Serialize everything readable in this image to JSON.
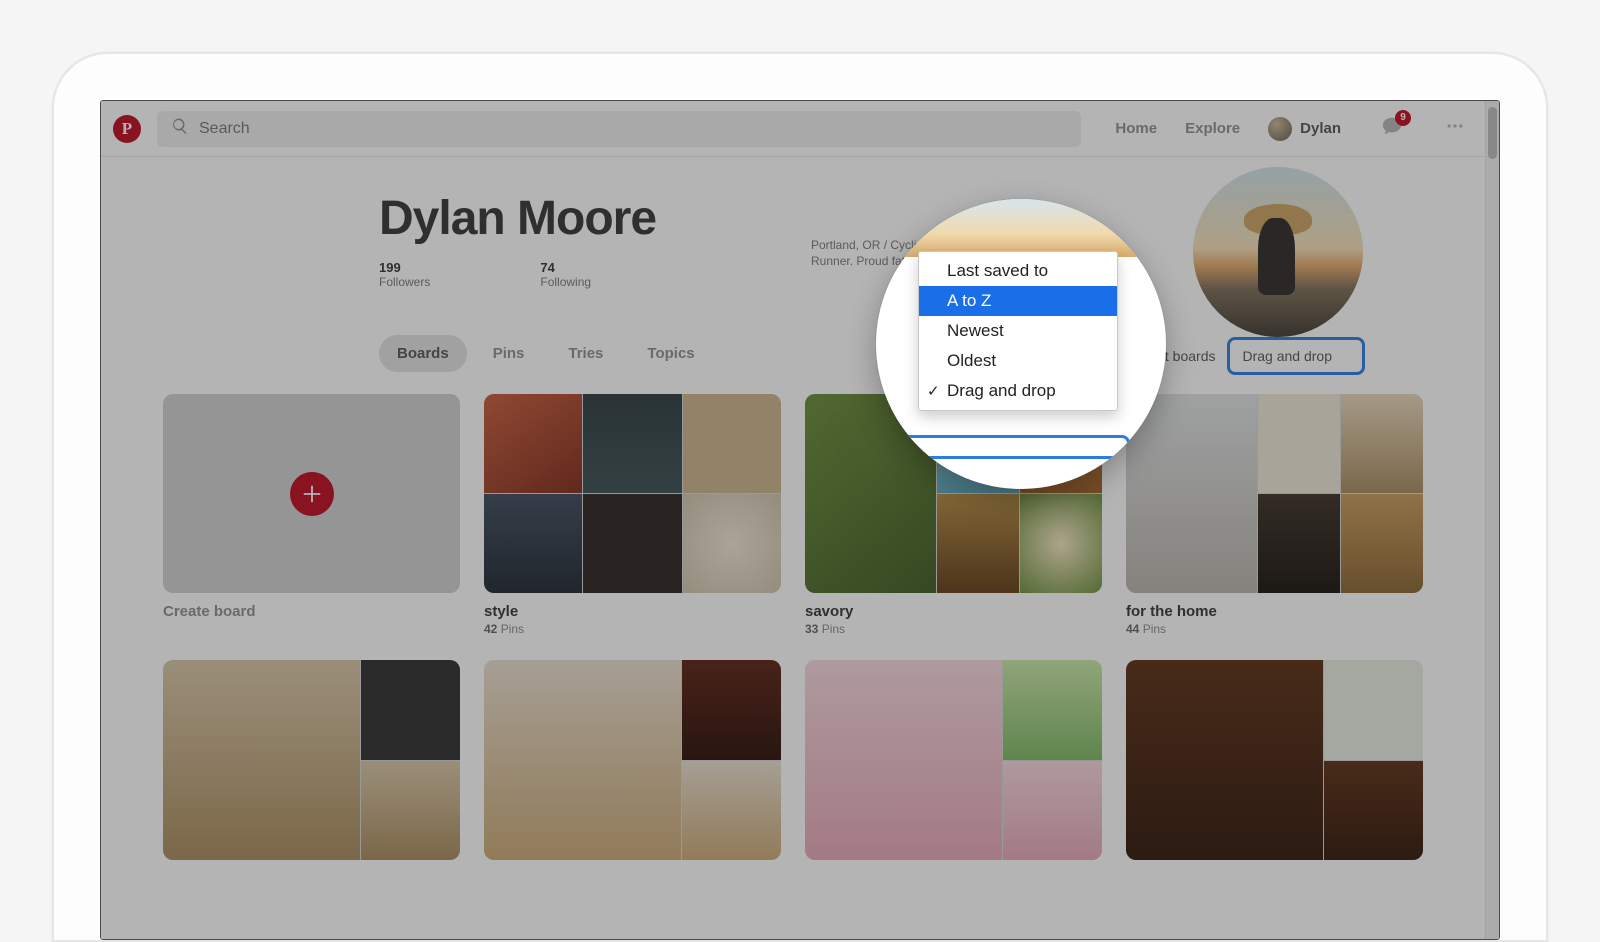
{
  "nav": {
    "search_placeholder": "Search",
    "links": {
      "home": "Home",
      "explore": "Explore"
    },
    "user_name": "Dylan",
    "messages_badge": "9"
  },
  "profile": {
    "display_name": "Dylan Moore",
    "followers": {
      "count": "199",
      "label": "Followers"
    },
    "following": {
      "count": "74",
      "label": "Following"
    },
    "bio": "Portland, OR / Cyclist and Runner. Proud father of two."
  },
  "tabs": {
    "boards": "Boards",
    "pins": "Pins",
    "tries": "Tries",
    "topics": "Topics",
    "active": "boards"
  },
  "sort": {
    "label_fragment": "Sort boards",
    "options": {
      "last_saved": "Last saved to",
      "a_to_z": "A to Z",
      "newest": "Newest",
      "oldest": "Oldest",
      "drag_drop": "Drag and drop"
    },
    "highlighted": "a_to_z",
    "checked": "drag_drop"
  },
  "boards": {
    "create_label": "Create board",
    "pins_word": "Pins",
    "items": [
      {
        "title": "style",
        "count": "42"
      },
      {
        "title": "savory",
        "count": "33"
      },
      {
        "title": "for the home",
        "count": "44"
      }
    ]
  }
}
